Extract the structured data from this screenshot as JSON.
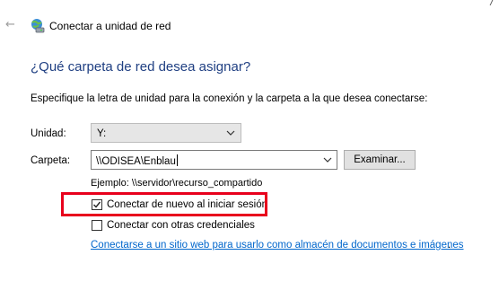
{
  "header": {
    "back_icon": "back-arrow-icon",
    "app_icon": "network-drive-icon",
    "title": "Conectar a unidad de red"
  },
  "main": {
    "heading": "¿Qué carpeta de red desea asignar?",
    "instruction": "Especifique la letra de unidad para la conexión y la carpeta a la que desea conectarse:",
    "drive": {
      "label": "Unidad:",
      "value": "Y:"
    },
    "folder": {
      "label": "Carpeta:",
      "value": "\\\\ODISEA\\Enblau",
      "browse_label": "Examinar...",
      "example": "Ejemplo: \\\\servidor\\recurso_compartido"
    },
    "options": {
      "reconnect": {
        "label": "Conectar de nuevo al iniciar sesión",
        "checked": true
      },
      "other_credentials": {
        "label": "Conectar con otras credenciales",
        "checked": false
      }
    },
    "web_link": {
      "text": "Conectarse a un sitio web para usarlo como almacén de documentos e imágenes",
      "trailing": "."
    }
  },
  "colors": {
    "heading": "#1f3f82",
    "link": "#0066cc",
    "highlight": "#e8001c"
  }
}
